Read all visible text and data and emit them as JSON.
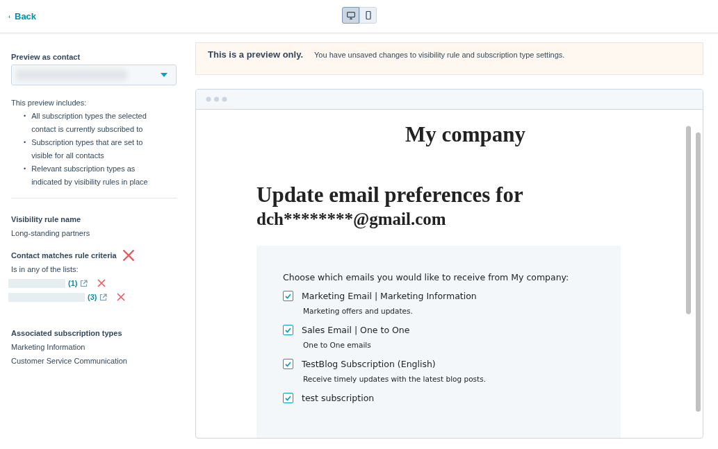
{
  "header": {
    "back_caret": "‹",
    "back_label": "Back",
    "device_toggle": [
      {
        "kind": "desktop",
        "selected": true
      },
      {
        "kind": "mobile",
        "selected": false
      }
    ]
  },
  "sidebar": {
    "preview_label": "Preview as contact",
    "includes_intro": "This preview includes:",
    "bullet": "•",
    "includes": [
      "All subscription types the selected contact is currently subscribed to",
      "Subscription types that are set to visible for all contacts",
      "Relevant subscription types as indicated by visibility rules in place"
    ],
    "rule_name_label": "Visibility rule name",
    "rule_name": "Long-standing partners",
    "criteria_label": "Contact matches rule criteria",
    "criteria_matched": false,
    "lists_intro": "Is in any of the lists:",
    "lists": [
      {
        "count": "(1)",
        "matched": false
      },
      {
        "count": "(3)",
        "matched": false
      }
    ],
    "types_label": "Associated subscription types",
    "types": [
      "Marketing Information",
      "Customer Service Communication"
    ]
  },
  "banner": {
    "title": "This is a preview only.",
    "message": "You have unsaved changes to visibility rule and subscription type settings."
  },
  "preview": {
    "company": "My company",
    "heading": "Update email preferences for",
    "email": "dch********@gmail.com",
    "intro": "Choose which emails you would like to receive from My company:",
    "subscriptions": [
      {
        "name": "Marketing Email | Marketing Information",
        "description": "Marketing offers and updates.",
        "checked": true
      },
      {
        "name": "Sales Email | One to One",
        "description": "One to One emails",
        "checked": true
      },
      {
        "name": "TestBlog Subscription (English)",
        "description": "Receive timely updates with the latest blog posts.",
        "checked": true
      },
      {
        "name": "test subscription",
        "checked": true
      }
    ]
  }
}
